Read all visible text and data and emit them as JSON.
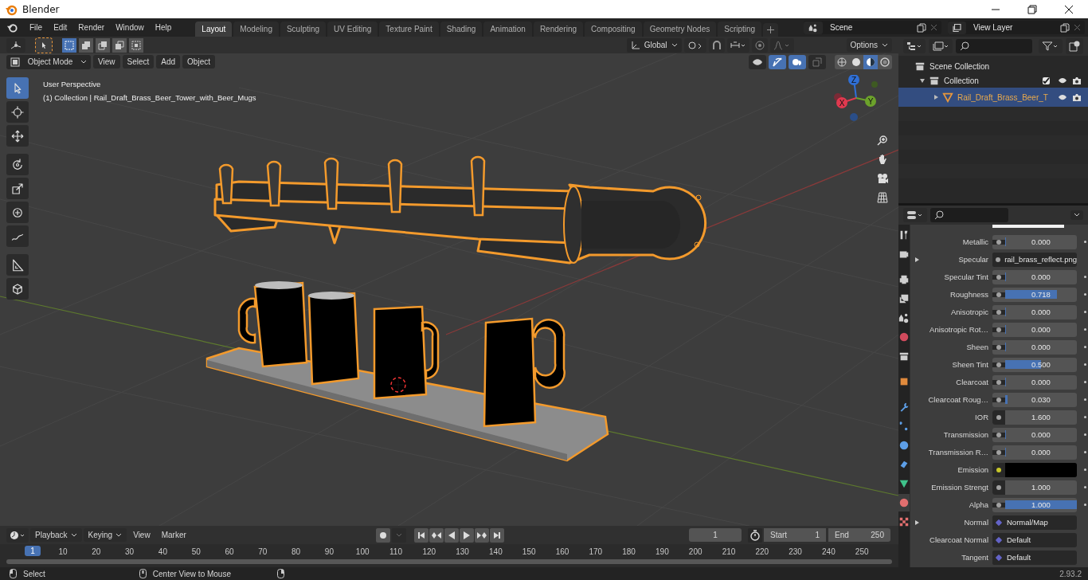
{
  "window": {
    "title": "Blender"
  },
  "menu": [
    "File",
    "Edit",
    "Render",
    "Window",
    "Help"
  ],
  "workspaces": [
    {
      "label": "Layout",
      "selected": true
    },
    {
      "label": "Modeling",
      "selected": false
    },
    {
      "label": "Sculpting",
      "selected": false
    },
    {
      "label": "UV Editing",
      "selected": false
    },
    {
      "label": "Texture Paint",
      "selected": false
    },
    {
      "label": "Shading",
      "selected": false
    },
    {
      "label": "Animation",
      "selected": false
    },
    {
      "label": "Rendering",
      "selected": false
    },
    {
      "label": "Compositing",
      "selected": false
    },
    {
      "label": "Geometry Nodes",
      "selected": false
    },
    {
      "label": "Scripting",
      "selected": false
    }
  ],
  "scene": {
    "name": "Scene"
  },
  "view_layer": {
    "name": "View Layer"
  },
  "viewport": {
    "orientation": "Global",
    "options": "Options",
    "mode": "Object Mode",
    "menus": [
      "View",
      "Select",
      "Add",
      "Object"
    ],
    "perspective": "User Perspective",
    "collection_info": "(1) Collection | Rail_Draft_Brass_Beer_Tower_with_Beer_Mugs",
    "toggles": [
      {
        "kind": "visibility",
        "on": false
      },
      {
        "kind": "gizmo",
        "on": true
      },
      {
        "kind": "overlay",
        "on": true
      },
      {
        "kind": "xray",
        "on": false
      }
    ],
    "shading": [
      {
        "kind": "wireframe",
        "selected": false
      },
      {
        "kind": "solid",
        "selected": false
      },
      {
        "kind": "material",
        "selected": true
      },
      {
        "kind": "rendered",
        "selected": false
      }
    ],
    "tools": [
      {
        "kind": "select",
        "selected": true
      },
      {
        "kind": "cursor",
        "selected": false
      },
      {
        "kind": "move",
        "selected": false
      },
      {
        "kind": "rotate",
        "selected": false
      },
      {
        "kind": "scale",
        "selected": false
      },
      {
        "kind": "transform",
        "selected": false
      },
      {
        "kind": "annotate",
        "selected": false
      },
      {
        "kind": "measure",
        "selected": false
      },
      {
        "kind": "add_cube",
        "selected": false
      }
    ],
    "gizmo": [
      {
        "label": "Z",
        "color": "#2f6fd6"
      },
      {
        "label": "X",
        "color": "#e0394f"
      },
      {
        "label": "Y",
        "color": "#6ca22b"
      }
    ]
  },
  "outliner": {
    "items": [
      {
        "label": "Scene Collection",
        "selected": false,
        "children": [
          {
            "label": "Collection",
            "selected": false,
            "expanded": true,
            "checked": true,
            "children": [
              {
                "label": "Rail_Draft_Brass_Beer_T",
                "selected": true,
                "expanded": false
              }
            ]
          }
        ]
      }
    ]
  },
  "properties": {
    "tabs": [
      {
        "kind": "tool",
        "selected": false
      },
      {
        "kind": "render",
        "selected": false
      },
      {
        "kind": "output",
        "selected": false
      },
      {
        "kind": "view_layer",
        "selected": false
      },
      {
        "kind": "scene",
        "selected": false
      },
      {
        "kind": "world",
        "selected": false
      },
      {
        "kind": "collection",
        "selected": false
      },
      {
        "kind": "object",
        "selected": false
      },
      {
        "kind": "modifier",
        "selected": false
      },
      {
        "kind": "particles",
        "selected": false
      },
      {
        "kind": "physics",
        "selected": false
      },
      {
        "kind": "constraints",
        "selected": false
      },
      {
        "kind": "data",
        "selected": false
      },
      {
        "kind": "material",
        "selected": true
      },
      {
        "kind": "texture",
        "selected": false
      }
    ],
    "rows": [
      {
        "label": "Metallic",
        "kind": "slider",
        "value": "0.000",
        "level": 0,
        "expandable": false,
        "color": "#a1a1a1"
      },
      {
        "label": "Specular",
        "kind": "texture",
        "value": "rail_brass_reflect.png",
        "expandable": true,
        "color": "#a1a1a1"
      },
      {
        "label": "Specular Tint",
        "kind": "slider",
        "value": "0.000",
        "level": 0,
        "expandable": false,
        "color": "#a1a1a1"
      },
      {
        "label": "Roughness",
        "kind": "slider",
        "value": "0.718",
        "level": 0.718,
        "expandable": false,
        "color": "#a1a1a1"
      },
      {
        "label": "Anisotropic",
        "kind": "slider",
        "value": "0.000",
        "level": 0,
        "expandable": false,
        "color": "#a1a1a1"
      },
      {
        "label": "Anisotropic Rot…",
        "kind": "slider",
        "value": "0.000",
        "level": 0,
        "expandable": false,
        "color": "#a1a1a1"
      },
      {
        "label": "Sheen",
        "kind": "slider",
        "value": "0.000",
        "level": 0,
        "expandable": false,
        "color": "#a1a1a1"
      },
      {
        "label": "Sheen Tint",
        "kind": "slider",
        "value": "0.500",
        "level": 0.5,
        "expandable": false,
        "color": "#a1a1a1"
      },
      {
        "label": "Clearcoat",
        "kind": "slider",
        "value": "0.000",
        "level": 0,
        "expandable": false,
        "color": "#a1a1a1"
      },
      {
        "label": "Clearcoat Roug…",
        "kind": "slider",
        "value": "0.030",
        "level": 0.03,
        "expandable": false,
        "color": "#a1a1a1"
      },
      {
        "label": "IOR",
        "kind": "number",
        "value": "1.600",
        "expandable": false,
        "color": "#a1a1a1"
      },
      {
        "label": "Transmission",
        "kind": "slider",
        "value": "0.000",
        "level": 0,
        "expandable": false,
        "color": "#a1a1a1"
      },
      {
        "label": "Transmission R…",
        "kind": "slider",
        "value": "0.000",
        "level": 0,
        "expandable": false,
        "color": "#a1a1a1"
      },
      {
        "label": "Emission",
        "kind": "color",
        "expandable": false,
        "color": "#c7c729"
      },
      {
        "label": "Emission Strengt",
        "kind": "number",
        "value": "1.000",
        "expandable": false,
        "color": "#a1a1a1"
      },
      {
        "label": "Alpha",
        "kind": "slider",
        "value": "1.000",
        "level": 1,
        "expandable": false,
        "color": "#a1a1a1"
      },
      {
        "label": "Normal",
        "kind": "vector",
        "value": "Normal/Map",
        "expandable": true,
        "color": "#6363c7"
      },
      {
        "label": "Clearcoat Normal",
        "kind": "vector",
        "value": "Default",
        "expandable": false,
        "color": "#6363c7"
      },
      {
        "label": "Tangent",
        "kind": "vector",
        "value": "Default",
        "expandable": false,
        "color": "#6363c7"
      }
    ]
  },
  "timeline": {
    "menus": [
      "Playback",
      "Keying",
      "View",
      "Marker"
    ],
    "current_frame": "1",
    "start_label": "Start",
    "start": "1",
    "end_label": "End",
    "end": "250",
    "playhead": "1",
    "ticks": [
      "10",
      "20",
      "30",
      "40",
      "50",
      "60",
      "70",
      "80",
      "90",
      "100",
      "110",
      "120",
      "130",
      "140",
      "150",
      "160",
      "170",
      "180",
      "190",
      "200",
      "210",
      "220",
      "230",
      "240",
      "250"
    ]
  },
  "status_bar": {
    "hints": [
      "Select",
      "Center View to Mouse"
    ],
    "version": "2.93.2"
  }
}
